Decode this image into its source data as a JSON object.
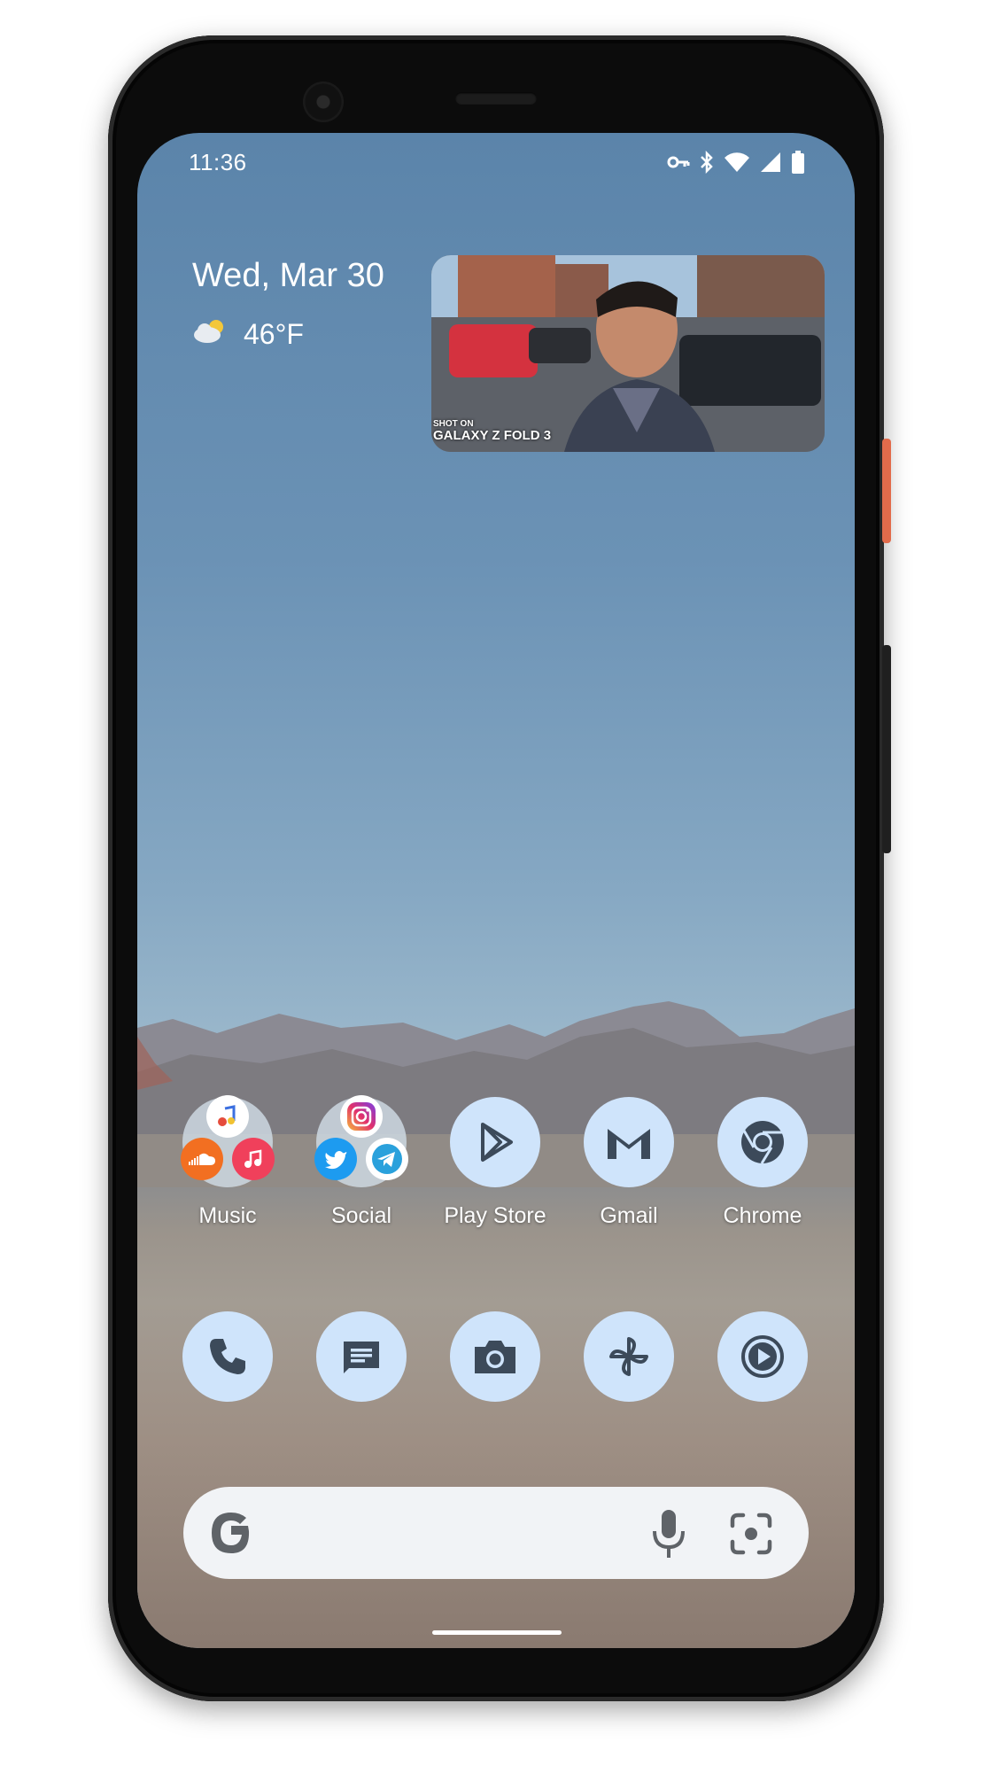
{
  "status_bar": {
    "time": "11:36",
    "icons": [
      "vpn-key-icon",
      "bluetooth-icon",
      "wifi-icon",
      "cell-signal-icon",
      "battery-icon"
    ]
  },
  "at_a_glance": {
    "date": "Wed, Mar 30",
    "weather_icon": "partly-cloudy-icon",
    "temperature": "46°F"
  },
  "video_widget": {
    "caption_line1": "SHOT ON",
    "caption_line2": "GALAXY Z FOLD 3"
  },
  "app_grid": [
    {
      "label": "Music",
      "type": "folder",
      "icons": [
        "youtube-music-icon",
        "soundcloud-icon",
        "apple-music-icon"
      ]
    },
    {
      "label": "Social",
      "type": "folder",
      "icons": [
        "instagram-icon",
        "twitter-icon",
        "telegram-icon"
      ]
    },
    {
      "label": "Play Store",
      "icon": "play-store-icon"
    },
    {
      "label": "Gmail",
      "icon": "gmail-icon"
    },
    {
      "label": "Chrome",
      "icon": "chrome-icon"
    }
  ],
  "dock": [
    {
      "icon": "phone-icon"
    },
    {
      "icon": "messages-icon"
    },
    {
      "icon": "camera-icon"
    },
    {
      "icon": "pinwheel-icon"
    },
    {
      "icon": "video-player-icon"
    }
  ],
  "search_bar": {
    "left_icon": "google-g-icon",
    "mic_icon": "microphone-icon",
    "lens_icon": "google-lens-icon"
  },
  "colors": {
    "icon_bg": "#cfe4fb",
    "icon_fg": "#3c4a5a",
    "phone_accent": "#e26b4b"
  }
}
